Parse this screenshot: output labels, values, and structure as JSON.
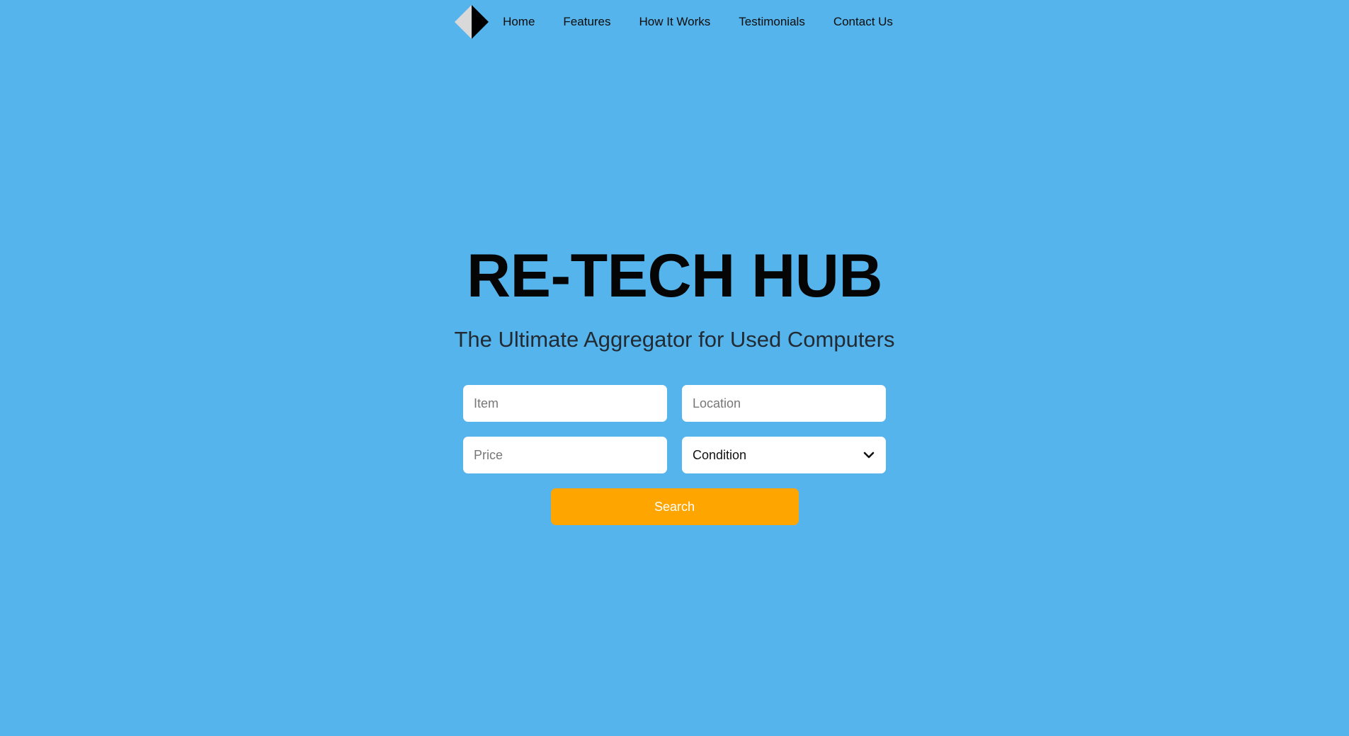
{
  "colors": {
    "background": "#55b4eb",
    "accent": "#ffa500",
    "field_background": "#ffffff",
    "text": "#050505"
  },
  "nav": {
    "logo_icon": "diamond-logo-icon",
    "links": [
      {
        "label": "Home"
      },
      {
        "label": "Features"
      },
      {
        "label": "How It Works"
      },
      {
        "label": "Testimonials"
      },
      {
        "label": "Contact Us"
      }
    ]
  },
  "hero": {
    "title": "RE-TECH HUB",
    "subtitle": "The Ultimate Aggregator for Used Computers"
  },
  "search": {
    "item_placeholder": "Item",
    "location_placeholder": "Location",
    "price_placeholder": "Price",
    "condition_value": "Condition",
    "condition_icon": "chevron-down-icon",
    "button_label": "Search"
  }
}
